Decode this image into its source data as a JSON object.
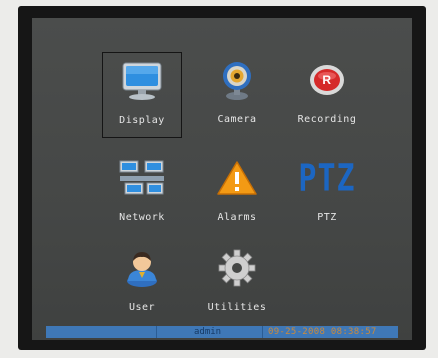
{
  "menu": {
    "items": [
      {
        "label": "Display",
        "icon": "display-monitor-icon",
        "selected": true
      },
      {
        "label": "Camera",
        "icon": "webcam-icon"
      },
      {
        "label": "Recording",
        "icon": "record-button-icon"
      },
      {
        "label": "Network",
        "icon": "network-computers-icon"
      },
      {
        "label": "Alarms",
        "icon": "warning-triangle-icon"
      },
      {
        "label": "PTZ",
        "icon": "ptz-text-icon",
        "glyph": "PTZ"
      },
      {
        "label": "User",
        "icon": "user-avatar-icon"
      },
      {
        "label": "Utilities",
        "icon": "gear-icon"
      }
    ]
  },
  "status_bar": {
    "user": "admin",
    "datetime": "09-25-2008 08:38:57"
  },
  "colors": {
    "screen_bg": "#474948",
    "status_bar": "#3f78b7",
    "datetime_text": "#cc8a3a",
    "label_text": "#e6e6e6"
  }
}
